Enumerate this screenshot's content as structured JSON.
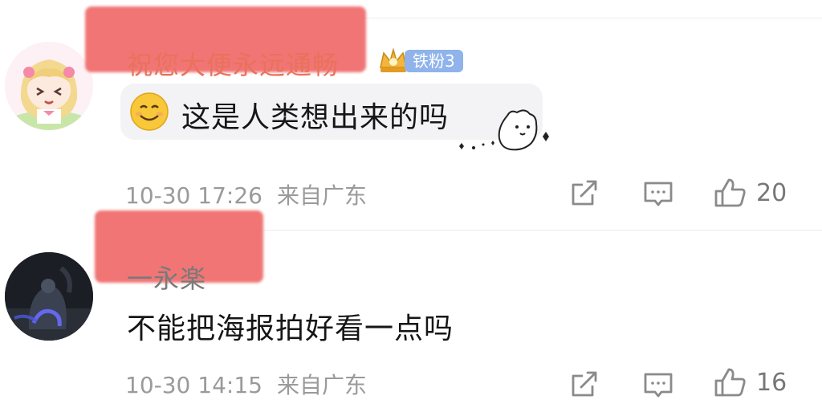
{
  "comments": [
    {
      "username": "祝您大便永远通畅",
      "badge_label": "铁粉3",
      "text": "这是人类想出来的吗",
      "date": "10-30 17:26",
      "location": "来自广东",
      "like_count": "20"
    },
    {
      "username": "一永楽",
      "text": "不能把海报拍好看一点吗",
      "date": "10-30 14:15",
      "location": "来自广东",
      "like_count": "16"
    }
  ],
  "colors": {
    "username_highlight": "#e8725b",
    "badge_blue": "#8fb3ea",
    "redaction": "#f06b6b",
    "meta_gray": "#9a9a9a"
  },
  "icons": [
    "share-icon",
    "comment-icon",
    "like-icon",
    "smile-emoji-icon",
    "bear-sticker-icon",
    "crown-icon"
  ]
}
